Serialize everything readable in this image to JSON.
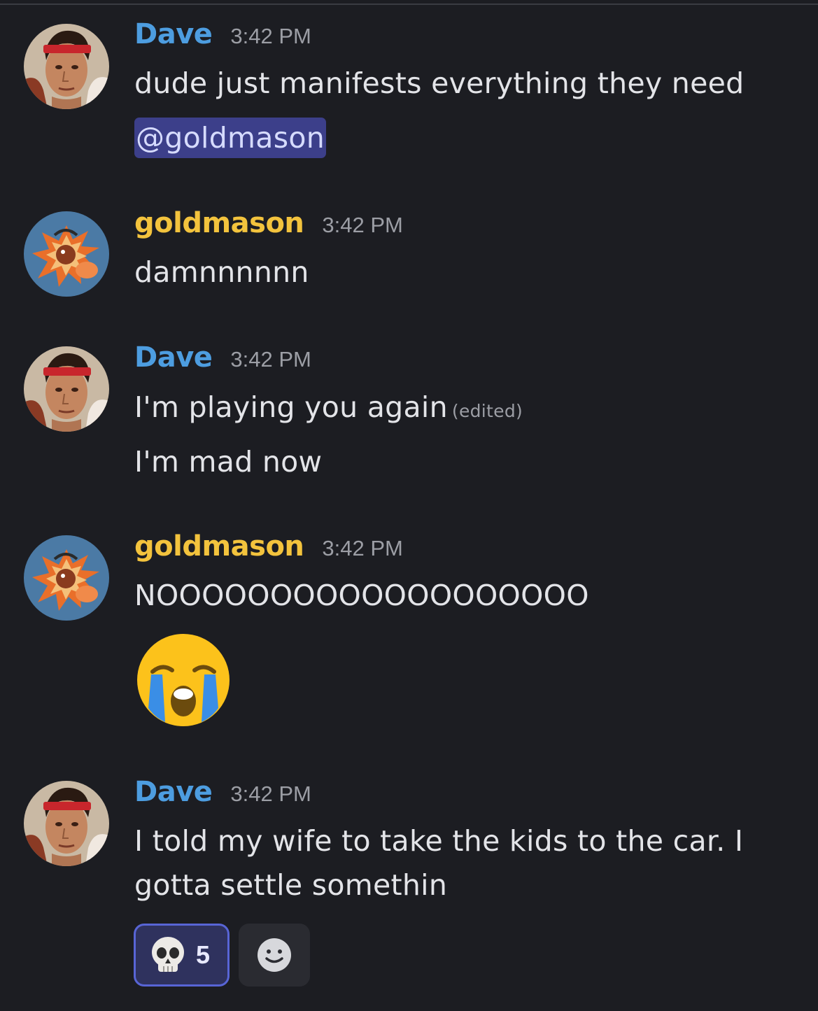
{
  "messages": [
    {
      "author": "Dave",
      "time": "3:42 PM",
      "lines": [
        "dude just manifests everything they need"
      ],
      "mention": "@goldmason"
    },
    {
      "author": "goldmason",
      "time": "3:42 PM",
      "lines": [
        "damnnnnnn"
      ]
    },
    {
      "author": "Dave",
      "time": "3:42 PM",
      "lines": [
        "I'm playing you again",
        "I'm mad now"
      ],
      "edited": "(edited)"
    },
    {
      "author": "goldmason",
      "time": "3:42 PM",
      "lines": [
        "NOOOOOOOOOOOOOOOOOOO"
      ],
      "emoji": "loudly-crying-face"
    },
    {
      "author": "Dave",
      "time": "3:42 PM",
      "lines": [
        "I told my wife to take the kids to the car. I",
        "gotta settle somethin"
      ],
      "reactions": [
        {
          "emoji": "skull-icon",
          "count": "5"
        }
      ]
    }
  ],
  "colors": {
    "background": "#1c1d22",
    "dave": "#4d9de0",
    "goldmason": "#f3c33d",
    "mention_bg": "#3c3f8a",
    "reaction_border": "#5865d6"
  }
}
